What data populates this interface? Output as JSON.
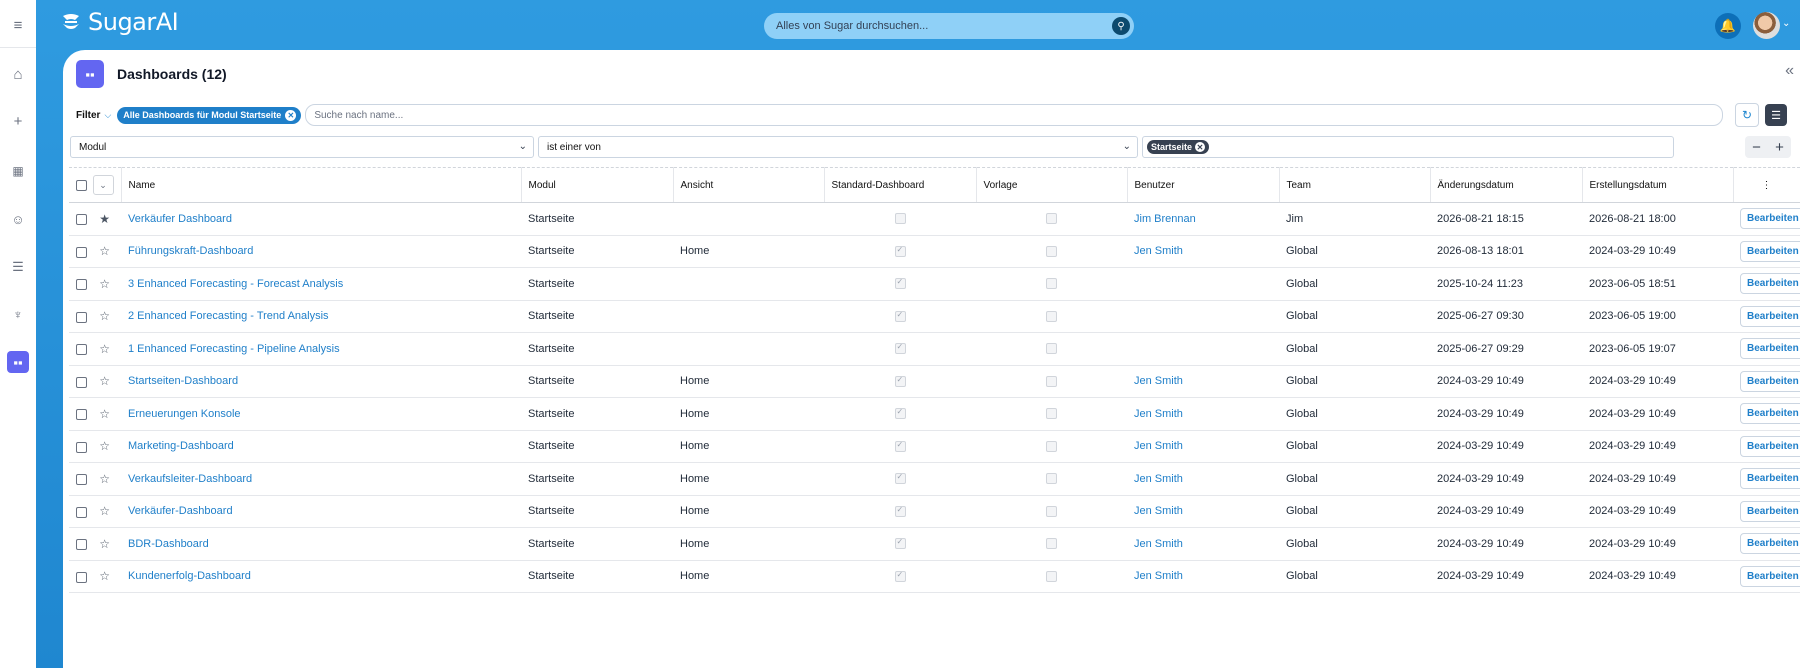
{
  "app": {
    "name": "SugarAI"
  },
  "search": {
    "placeholder": "Alles von Sugar durchsuchen..."
  },
  "page": {
    "title": "Dashboards (12)"
  },
  "filter": {
    "label": "Filter",
    "active_filter": "Alle Dashboards für Modul Startseite",
    "name_search_placeholder": "Suche nach name...",
    "field": "Modul",
    "operator": "ist einer von",
    "value_tag": "Startseite"
  },
  "colors": {
    "brand_blue": "#1f87d0",
    "accent_purple": "#6366f1"
  },
  "columns": [
    "Name",
    "Modul",
    "Ansicht",
    "Standard-Dashboard",
    "Vorlage",
    "Benutzer",
    "Team",
    "Änderungsdatum",
    "Erstellungsdatum"
  ],
  "edit_label": "Bearbeiten",
  "rows": [
    {
      "name": "Verkäufer Dashboard",
      "modul": "Startseite",
      "ansicht": "",
      "standard": false,
      "vorlage": false,
      "benutzer": "Jim Brennan",
      "team": "Jim",
      "changed": "2026-08-21 18:15",
      "created": "2026-08-21 18:00",
      "fav": true
    },
    {
      "name": "Führungskraft-Dashboard",
      "modul": "Startseite",
      "ansicht": "Home",
      "standard": true,
      "vorlage": false,
      "benutzer": "Jen Smith",
      "team": "Global",
      "changed": "2026-08-13 18:01",
      "created": "2024-03-29 10:49",
      "fav": false
    },
    {
      "name": "3 Enhanced Forecasting - Forecast Analysis",
      "modul": "Startseite",
      "ansicht": "",
      "standard": true,
      "vorlage": false,
      "benutzer": "",
      "team": "Global",
      "changed": "2025-10-24 11:23",
      "created": "2023-06-05 18:51",
      "fav": false
    },
    {
      "name": "2 Enhanced Forecasting - Trend Analysis",
      "modul": "Startseite",
      "ansicht": "",
      "standard": true,
      "vorlage": false,
      "benutzer": "",
      "team": "Global",
      "changed": "2025-06-27 09:30",
      "created": "2023-06-05 19:00",
      "fav": false
    },
    {
      "name": "1 Enhanced Forecasting - Pipeline Analysis",
      "modul": "Startseite",
      "ansicht": "",
      "standard": true,
      "vorlage": false,
      "benutzer": "",
      "team": "Global",
      "changed": "2025-06-27 09:29",
      "created": "2023-06-05 19:07",
      "fav": false
    },
    {
      "name": "Startseiten-Dashboard",
      "modul": "Startseite",
      "ansicht": "Home",
      "standard": true,
      "vorlage": false,
      "benutzer": "Jen Smith",
      "team": "Global",
      "changed": "2024-03-29 10:49",
      "created": "2024-03-29 10:49",
      "fav": false
    },
    {
      "name": "Erneuerungen Konsole",
      "modul": "Startseite",
      "ansicht": "Home",
      "standard": true,
      "vorlage": false,
      "benutzer": "Jen Smith",
      "team": "Global",
      "changed": "2024-03-29 10:49",
      "created": "2024-03-29 10:49",
      "fav": false
    },
    {
      "name": "Marketing-Dashboard",
      "modul": "Startseite",
      "ansicht": "Home",
      "standard": true,
      "vorlage": false,
      "benutzer": "Jen Smith",
      "team": "Global",
      "changed": "2024-03-29 10:49",
      "created": "2024-03-29 10:49",
      "fav": false
    },
    {
      "name": "Verkaufsleiter-Dashboard",
      "modul": "Startseite",
      "ansicht": "Home",
      "standard": true,
      "vorlage": false,
      "benutzer": "Jen Smith",
      "team": "Global",
      "changed": "2024-03-29 10:49",
      "created": "2024-03-29 10:49",
      "fav": false
    },
    {
      "name": "Verkäufer-Dashboard",
      "modul": "Startseite",
      "ansicht": "Home",
      "standard": true,
      "vorlage": false,
      "benutzer": "Jen Smith",
      "team": "Global",
      "changed": "2024-03-29 10:49",
      "created": "2024-03-29 10:49",
      "fav": false
    },
    {
      "name": "BDR-Dashboard",
      "modul": "Startseite",
      "ansicht": "Home",
      "standard": true,
      "vorlage": false,
      "benutzer": "Jen Smith",
      "team": "Global",
      "changed": "2024-03-29 10:49",
      "created": "2024-03-29 10:49",
      "fav": false
    },
    {
      "name": "Kundenerfolg-Dashboard",
      "modul": "Startseite",
      "ansicht": "Home",
      "standard": true,
      "vorlage": false,
      "benutzer": "Jen Smith",
      "team": "Global",
      "changed": "2024-03-29 10:49",
      "created": "2024-03-29 10:49",
      "fav": false
    }
  ]
}
